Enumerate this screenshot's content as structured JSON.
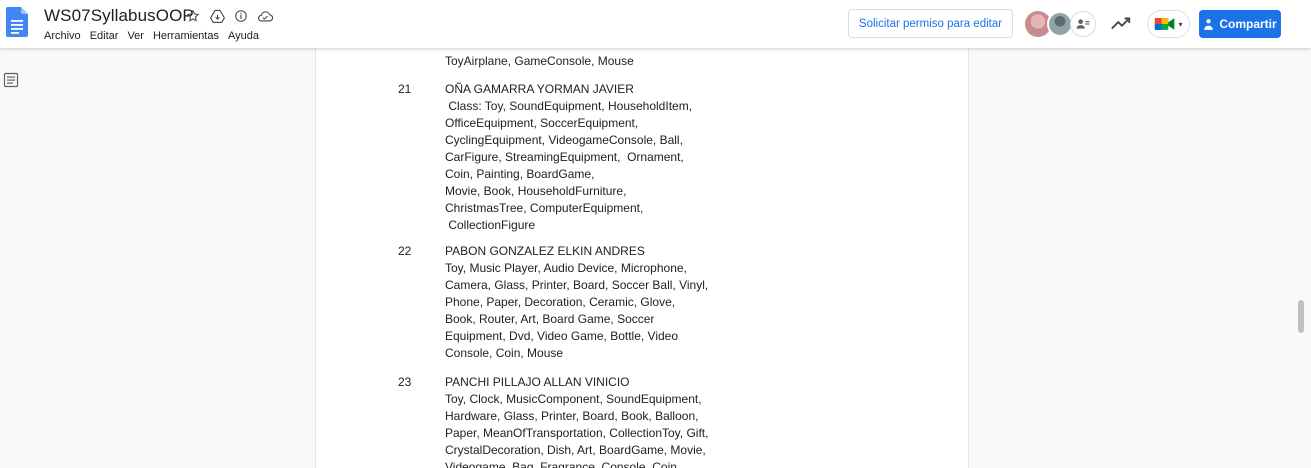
{
  "header": {
    "doc_title": "WS07SyllabusOOP",
    "menu": [
      "Archivo",
      "Editar",
      "Ver",
      "Herramientas",
      "Ayuda"
    ],
    "request_edit_label": "Solicitar permiso para editar",
    "share_label": "Compartir"
  },
  "colors": {
    "accent": "#1a73e8",
    "docs_blue": "#4285f4"
  },
  "document": {
    "top_partial_line": "ToyAirplane, GameConsole, Mouse",
    "entries": [
      {
        "number": "21",
        "lines": [
          "OÑA GAMARRA YORMAN JAVIER",
          " Class: Toy, SoundEquipment, HouseholdItem,",
          "OfficeEquipment, SoccerEquipment,",
          "CyclingEquipment, VideogameConsole, Ball,",
          "CarFigure, StreamingEquipment,  Ornament,",
          "Coin, Painting, BoardGame,",
          "Movie, Book, HouseholdFurniture,",
          "ChristmasTree, ComputerEquipment,",
          " CollectionFigure"
        ]
      },
      {
        "number": "22",
        "lines": [
          "PABON GONZALEZ ELKIN ANDRES",
          "Toy, Music Player, Audio Device, Microphone,",
          "Camera, Glass, Printer, Board, Soccer Ball, Vinyl,",
          "Phone, Paper, Decoration, Ceramic, Glove,",
          "Book, Router, Art, Board Game, Soccer",
          "Equipment, Dvd, Video Game, Bottle, Video",
          "Console, Coin, Mouse"
        ]
      },
      {
        "number": "23",
        "lines": [
          "PANCHI PILLAJO ALLAN VINICIO",
          "Toy, Clock, MusicComponent, SoundEquipment,",
          "Hardware, Glass, Printer, Board, Book, Balloon,",
          "Paper, MeanOfTransportation, CollectionToy, Gift,",
          "CrystalDecoration, Dish, Art, BoardGame, Movie,",
          "Videogame, Bag, Fragrance, Console, Coin,"
        ]
      }
    ]
  }
}
